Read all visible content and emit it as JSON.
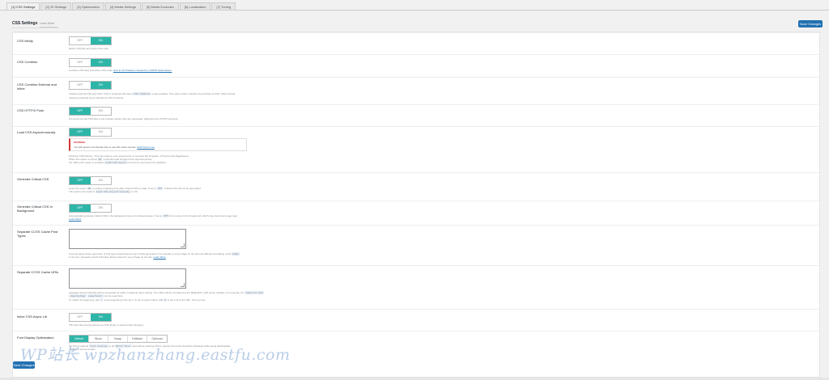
{
  "tabs": [
    {
      "label": "[1] CSS Settings",
      "active": true
    },
    {
      "label": "[2] JS Settings"
    },
    {
      "label": "[3] Optimization"
    },
    {
      "label": "[4] Media Settings"
    },
    {
      "label": "[5] Media Excludes"
    },
    {
      "label": "[6] Localization"
    },
    {
      "label": "[7] Tuning"
    }
  ],
  "header": {
    "title": "CSS Settings",
    "sub": "Learn More",
    "save_top": "Save Changes",
    "save_bottom": "Save Changes"
  },
  "toggle": {
    "off": "OFF",
    "on": "ON"
  },
  "rows": {
    "minify": {
      "label": "CSS Minify",
      "desc": "Minify CSS files and inline CSS code."
    },
    "combine": {
      "label": "CSS Combine",
      "desc": "Combine CSS files and inline CSS code.",
      "link": "How to Fix Problems Caused by CSS/JS Optimization."
    },
    "combine_ext": {
      "label": "CSS Combine External and Inline",
      "desc1": "Include external CSS and inline CSS in combined file when",
      "code": "CSS Combine",
      "desc1b": "is also enabled. This option helps maintain the priorities of CSS, which should",
      "desc2": "minimize potential errors caused by CSS Combine."
    },
    "http2": {
      "label": "CSS HTTP/2 Push",
      "desc": "Pre-send internal CSS files to the browser before they are requested. (Requires the HTTP/2 protocol)"
    },
    "async": {
      "label": "Load CSS Asynchronously",
      "notice_title": "WARNING",
      "notice_body": "You will need to set Domain Key to use this online service.",
      "notice_link": "Click here to set",
      "desc1": "Optimize CSS delivery. This can improve your speed score in services like Pingdom, GTmetrix and PageSpeed.",
      "desc2": "When this option is turned",
      "desc2b": "ON",
      "desc2c": ", it will also load Google Fonts asynchronously.",
      "desc3": "Tip: When this option is enabled,",
      "desc3code": "Load CSS Async",
      "desc3b": "is forced on and cannot be disabled."
    },
    "ccss": {
      "label": "Generate Critical CSS",
      "desc1": "Learn the option",
      "code1": "ON",
      "desc1b": "to reduce rendering time after Critical CSS is ready. If set to",
      "code2": "OFF",
      "desc1c": ", Critical CSS will not be generated.",
      "desc2": "This option only works if",
      "code3": "Load CSS Asynchronously",
      "desc2b": "is ON."
    },
    "ccss_bg": {
      "label": "Generate Critical CSS In Background",
      "desc1": "Automatically generate critical CSS in the background via a cron-based queue. If set to",
      "code": "OFF",
      "desc1b": "this is done in the foreground, which may slow down page load.",
      "link": "Learn More"
    },
    "ccss_post": {
      "label": "Separate CCSS Cache Post Types",
      "desc": "List post types where each item of that type should have its own CCSS generated. For example, if every Page on the site has different formatting, enter",
      "code": "page",
      "desc2": "in the box. Separate critical CSS files will be stored for every Page on the site.",
      "link": "Learn More"
    },
    "ccss_uri": {
      "label": "Separate CCSS Cache URIs",
      "desc1": "Separate critical CSS files will be generated for paths containing these strings. The URLs will be compared to the REQUEST_URI server variable. For example, for",
      "code1": "/aaa/xxx.php",
      "desc2a": "",
      "code2": "/aaa/mytag/",
      "code3": "/aaa/test/",
      "desc2b": "can be used here.",
      "desc3": "To match the beginning, add",
      "code4": "^",
      "desc3b": "to the beginning of the item. To do an exact match, add",
      "code5": "$",
      "desc3c": "to the end of the URL. One per line."
    },
    "inline_js": {
      "label": "Inline CSS Async Lib",
      "desc": "This will inline the asynchronous CSS library to avoid render blocking."
    },
    "font": {
      "label": "Font Display Optimization",
      "options": [
        "Default",
        "Block",
        "Swap",
        "Fallback",
        "Optional"
      ],
      "desc1": "Set this to append",
      "code1": "font-display",
      "desc1b": "to all",
      "code2": "@font-face",
      "desc1c": "rules before caching CSS to specify how fonts should be displayed while being downloaded.",
      "code3": "Swap",
      "desc2": "is recommended."
    }
  },
  "watermark": "WP站长  wpzhanzhang.eastfu.com"
}
